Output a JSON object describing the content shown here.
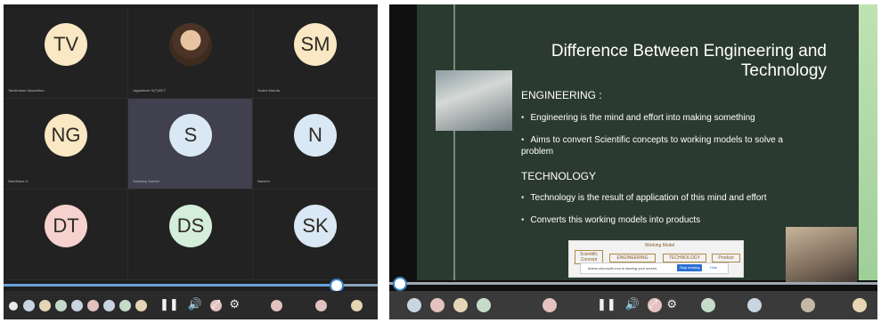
{
  "participants": [
    {
      "initials": "TV",
      "color": "#f9e8c3",
      "name": "Tamilmaran Vasanthan"
    },
    {
      "initials": "",
      "color": "#7a5a3c",
      "name": "Jagadeesh S(T)MCT",
      "photo": true
    },
    {
      "initials": "SM",
      "color": "#f9e8c3",
      "name": "Sudha Manda"
    },
    {
      "initials": "NG",
      "color": "#f9e8c3",
      "name": "Nandhana G"
    },
    {
      "initials": "S",
      "color": "#d9e8f4",
      "name": "Sandeep Suresh",
      "active": true
    },
    {
      "initials": "N",
      "color": "#d9e8f4",
      "name": "Naveen"
    },
    {
      "initials": "DT",
      "color": "#f6d2ce",
      "name": ""
    },
    {
      "initials": "DS",
      "color": "#d5eedb",
      "name": ""
    },
    {
      "initials": "SK",
      "color": "#d9e8f4",
      "name": ""
    }
  ],
  "slide": {
    "title_line1": "Difference Between Engineering and",
    "title_line2": "Technology",
    "engineering_heading": "ENGINEERING :",
    "engineering_points": [
      "Engineering is the mind and effort into making something",
      "Aims to convert Scientific concepts to working models to solve a problem"
    ],
    "technology_heading": "TECHNOLOGY",
    "technology_points": [
      "Technology is the result of application of this mind and effort",
      "Converts this working models into products"
    ],
    "diagram": {
      "box1": "Scientific Concept",
      "box2": "ENGINEERING",
      "box2_top": "Working Model",
      "box3": "TECHNOLOGY",
      "box4": "Product"
    },
    "share_bar": {
      "text": "teams.microsoft.com is sharing your screen.",
      "stop_button": "Stop sharing",
      "hide_button": "Hide"
    }
  },
  "player": {
    "left_progress": 0.89,
    "right_progress": 0.02,
    "pause_icon": "pause-icon",
    "volume_icon": "volume-icon",
    "fullscreen_icon": "expand-icon",
    "settings_icon": "gear-icon"
  }
}
